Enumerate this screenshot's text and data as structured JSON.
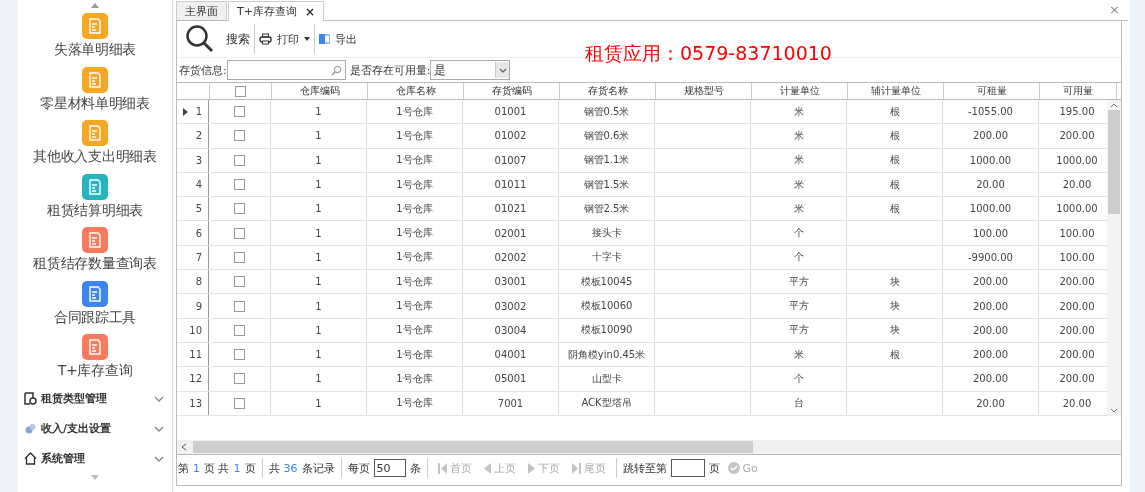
{
  "sidebar": {
    "items": [
      {
        "label": "失落单明细表",
        "color": "#f5a623"
      },
      {
        "label": "零星材料单明细表",
        "color": "#f5a623"
      },
      {
        "label": "其他收入支出明细表",
        "color": "#f5a623"
      },
      {
        "label": "租赁结算明细表",
        "color": "#26b5bd"
      },
      {
        "label": "租赁结存数量查询表",
        "color": "#fa7a5e"
      },
      {
        "label": "合同跟踪工具",
        "color": "#3d86f0"
      },
      {
        "label": "T+库存查询",
        "color": "#fa7a5e"
      }
    ],
    "sections": [
      {
        "label": "租赁类型管理",
        "kind": "settings",
        "expanded": false
      },
      {
        "label": "收入/支出设置",
        "kind": "gems",
        "expanded": false
      },
      {
        "label": "系统管理",
        "kind": "home",
        "expanded": false
      }
    ]
  },
  "tabs": [
    {
      "label": "主界面",
      "selected": false
    },
    {
      "label": "T+库存查询",
      "selected": true,
      "close": "×"
    }
  ],
  "window_close": "×",
  "toolbar": [
    {
      "label": "搜索",
      "kind": "search"
    },
    {
      "label": "打印",
      "kind": "print"
    },
    {
      "label": "导出",
      "kind": "export"
    }
  ],
  "banner": "租赁应用：0579-83710010",
  "filters": {
    "info_label": "存货信息:",
    "avail_label": "是否存在可用量:",
    "avail_value": "是"
  },
  "table": {
    "select_all_checked": false,
    "columns": [
      "仓库编码",
      "仓库名称",
      "存货编码",
      "存货名称",
      "规格型号",
      "计量单位",
      "辅计量单位",
      "可租量",
      "可用量"
    ],
    "rows": [
      {
        "no": "1",
        "current": true,
        "checked": false,
        "cells": [
          "1",
          "1号仓库",
          "01001",
          "钢管0.5米",
          "",
          "米",
          "根",
          "-1055.00",
          "195.00"
        ]
      },
      {
        "no": "2",
        "current": false,
        "checked": false,
        "cells": [
          "1",
          "1号仓库",
          "01002",
          "钢管0.6米",
          "",
          "米",
          "根",
          "200.00",
          "200.00"
        ]
      },
      {
        "no": "3",
        "current": false,
        "checked": false,
        "cells": [
          "1",
          "1号仓库",
          "01007",
          "钢管1.1米",
          "",
          "米",
          "根",
          "1000.00",
          "1000.00"
        ]
      },
      {
        "no": "4",
        "current": false,
        "checked": false,
        "cells": [
          "1",
          "1号仓库",
          "01011",
          "钢管1.5米",
          "",
          "米",
          "根",
          "20.00",
          "20.00"
        ]
      },
      {
        "no": "5",
        "current": false,
        "checked": false,
        "cells": [
          "1",
          "1号仓库",
          "01021",
          "钢管2.5米",
          "",
          "米",
          "根",
          "1000.00",
          "1000.00"
        ]
      },
      {
        "no": "6",
        "current": false,
        "checked": false,
        "cells": [
          "1",
          "1号仓库",
          "02001",
          "接头卡",
          "",
          "个",
          "",
          "100.00",
          "100.00"
        ]
      },
      {
        "no": "7",
        "current": false,
        "checked": false,
        "cells": [
          "1",
          "1号仓库",
          "02002",
          "十字卡",
          "",
          "个",
          "",
          "-9900.00",
          "100.00"
        ]
      },
      {
        "no": "8",
        "current": false,
        "checked": false,
        "cells": [
          "1",
          "1号仓库",
          "03001",
          "模板10045",
          "",
          "平方",
          "块",
          "200.00",
          "200.00"
        ]
      },
      {
        "no": "9",
        "current": false,
        "checked": false,
        "cells": [
          "1",
          "1号仓库",
          "03002",
          "模板10060",
          "",
          "平方",
          "块",
          "200.00",
          "200.00"
        ]
      },
      {
        "no": "10",
        "current": false,
        "checked": false,
        "cells": [
          "1",
          "1号仓库",
          "03004",
          "模板10090",
          "",
          "平方",
          "块",
          "200.00",
          "200.00"
        ]
      },
      {
        "no": "11",
        "current": false,
        "checked": false,
        "cells": [
          "1",
          "1号仓库",
          "04001",
          "阴角模yin0.45米",
          "",
          "米",
          "根",
          "200.00",
          "200.00"
        ]
      },
      {
        "no": "12",
        "current": false,
        "checked": false,
        "cells": [
          "1",
          "1号仓库",
          "05001",
          "山型卡",
          "",
          "个",
          "",
          "200.00",
          "200.00"
        ]
      },
      {
        "no": "13",
        "current": false,
        "checked": false,
        "cells": [
          "1",
          "1号仓库",
          "7001",
          "ACK型塔吊",
          "",
          "台",
          "",
          "20.00",
          "20.00"
        ]
      }
    ]
  },
  "pager": {
    "page_prefix": "第",
    "page": "1",
    "page_mid": "页 共",
    "pages": "1",
    "page_suffix": "页",
    "total_prefix": "共",
    "total": "36",
    "total_suffix": "条记录",
    "per_label": "每页",
    "per_value": "50",
    "per_suffix": "条",
    "nav": [
      {
        "label": "首页",
        "kind": "first",
        "disabled": true
      },
      {
        "label": "上页",
        "kind": "prev",
        "disabled": true
      },
      {
        "label": "下页",
        "kind": "next",
        "disabled": true
      },
      {
        "label": "尾页",
        "kind": "last",
        "disabled": true
      }
    ],
    "jump_label": "跳转至第",
    "jump_suffix": "页",
    "go": {
      "label": "Go",
      "disabled": true
    }
  }
}
